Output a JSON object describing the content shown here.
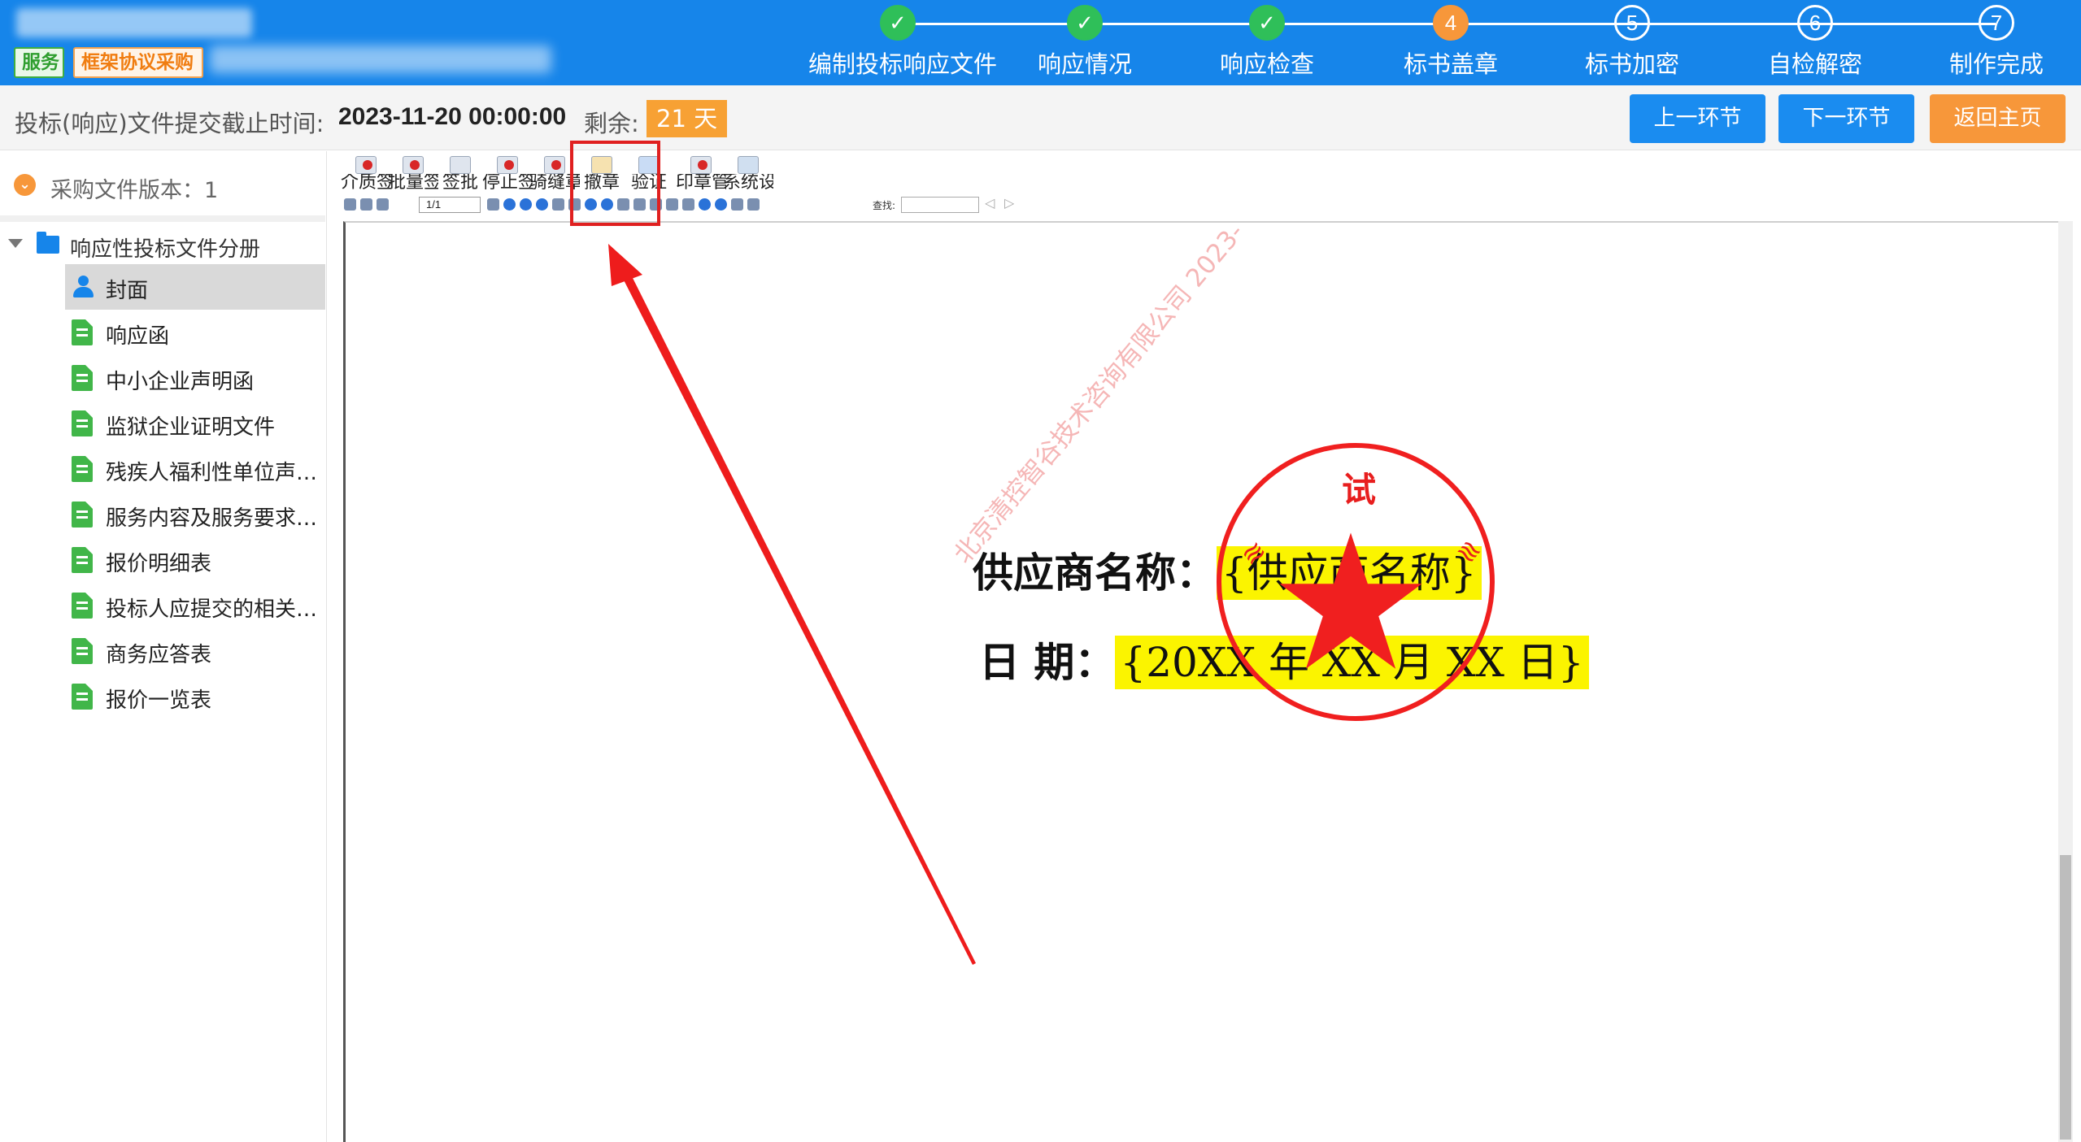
{
  "header": {
    "tags": {
      "service": "服务",
      "framework": "框架协议采购"
    },
    "steps": [
      {
        "num": "1",
        "label": "编制投标响应文件",
        "status": "done"
      },
      {
        "num": "2",
        "label": "响应情况",
        "status": "done"
      },
      {
        "num": "3",
        "label": "响应检查",
        "status": "done"
      },
      {
        "num": "4",
        "label": "标书盖章",
        "status": "current"
      },
      {
        "num": "5",
        "label": "标书加密",
        "status": "todo"
      },
      {
        "num": "6",
        "label": "自检解密",
        "status": "todo"
      },
      {
        "num": "7",
        "label": "制作完成",
        "status": "todo"
      }
    ]
  },
  "infobar": {
    "deadline_label": "投标(响应)文件提交截止时间:",
    "deadline_value": "2023-11-20 00:00:00",
    "remain_label": "剩余:",
    "remain_value": "21 天",
    "prev_label": "上一环节",
    "next_label": "下一环节",
    "home_label": "返回主页"
  },
  "sidebar": {
    "version_label": "采购文件版本：1",
    "folder_label": "响应性投标文件分册",
    "items": [
      {
        "label": "封面",
        "icon": "user-icon",
        "active": true
      },
      {
        "label": "响应函",
        "icon": "doc-icon"
      },
      {
        "label": "中小企业声明函",
        "icon": "doc-icon"
      },
      {
        "label": "监狱企业证明文件",
        "icon": "doc-icon"
      },
      {
        "label": "残疾人福利性单位声明函",
        "icon": "doc-icon"
      },
      {
        "label": "服务内容及服务要求应...",
        "icon": "doc-icon"
      },
      {
        "label": "报价明细表",
        "icon": "doc-icon"
      },
      {
        "label": "投标人应提交的相关证明",
        "icon": "doc-icon"
      },
      {
        "label": "商务应答表",
        "icon": "doc-icon"
      },
      {
        "label": "报价一览表",
        "icon": "doc-icon"
      }
    ]
  },
  "toolbar": {
    "buttons": [
      "介质签章",
      "批量签章",
      "签批",
      "停止签",
      "骑缝章",
      "撤章",
      "验证",
      "印章管理",
      "系统设置"
    ],
    "page": "1/1",
    "find_label": "查找:"
  },
  "document": {
    "watermark": "北京清控智谷技术咨询有限公司 2023-",
    "line1_label": "供应商名称：",
    "line1_value": "{供应商名称}",
    "line2_label": "日  期：",
    "line2_value": "{20XX 年 XX 月 XX 日}",
    "seal_top_text": "试"
  },
  "colors": {
    "header_bg": "#1685ea",
    "step_done": "#2fbf59",
    "step_current": "#f7973a",
    "accent_orange": "#f7973a",
    "seal_red": "#f01f1f",
    "highlight_yellow": "#fbf400"
  }
}
